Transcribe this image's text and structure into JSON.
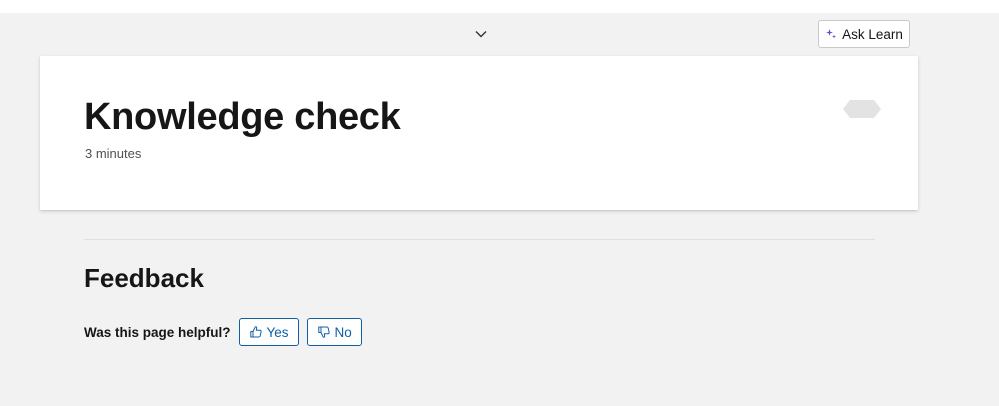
{
  "header": {
    "expand_icon": "chevron-down-icon",
    "ask_learn": {
      "label": "Ask Learn",
      "icon": "sparkle-icon"
    }
  },
  "unit": {
    "title": "Knowledge check",
    "duration": "3 minutes",
    "badge_icon": "hexagon-badge-icon"
  },
  "feedback": {
    "title": "Feedback",
    "question": "Was this page helpful?",
    "yes": {
      "label": "Yes",
      "icon": "thumbs-up-icon"
    },
    "no": {
      "label": "No",
      "icon": "thumbs-down-icon"
    }
  },
  "colors": {
    "page_background": "#f2f2f2",
    "card_background": "#ffffff",
    "accent": "#0f5ea8",
    "sparkle_accent": "#6a4bc4"
  }
}
